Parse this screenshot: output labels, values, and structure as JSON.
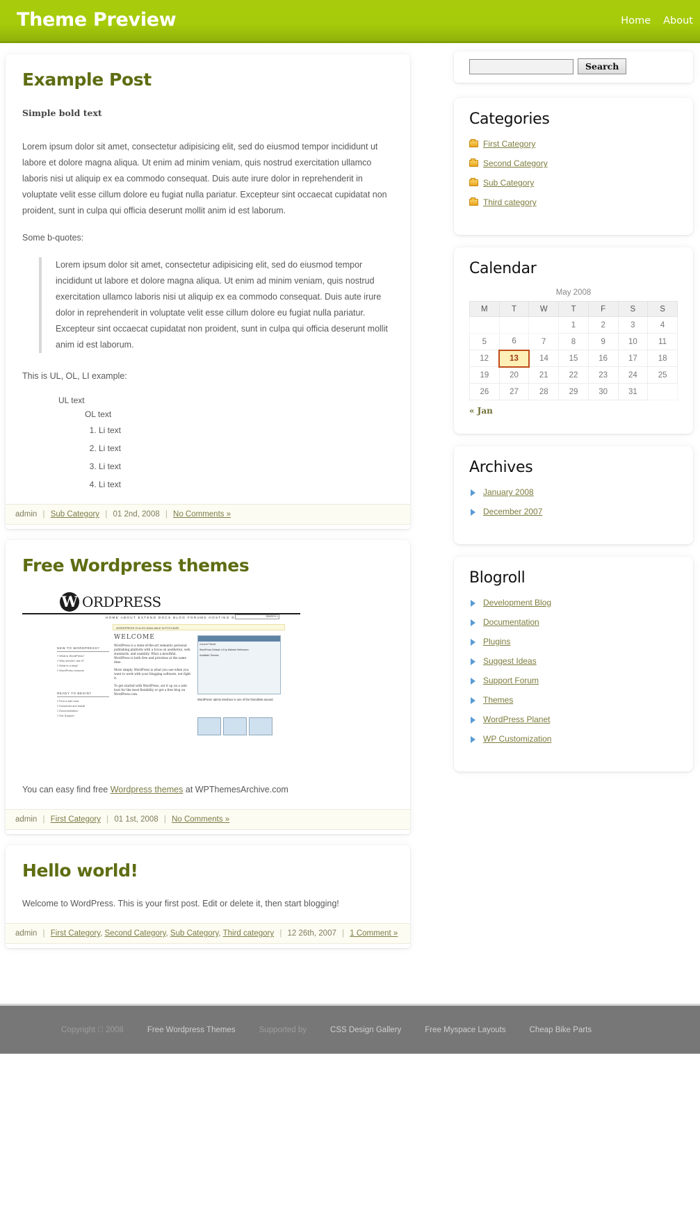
{
  "header": {
    "blog_title": "Theme Preview",
    "nav": [
      {
        "label": "Home"
      },
      {
        "label": "About"
      }
    ]
  },
  "posts": [
    {
      "title": "Example Post",
      "bold_intro": "Simple bold text",
      "paragraph1": "Lorem ipsum dolor sit amet, consectetur adipisicing elit, sed do eiusmod tempor incididunt ut labore et dolore magna aliqua. Ut enim ad minim veniam, quis nostrud exercitation ullamco laboris nisi ut aliquip ex ea commodo consequat. Duis aute irure dolor in reprehenderit in voluptate velit esse cillum dolore eu fugiat nulla pariatur. Excepteur sint occaecat cupidatat non proident, sunt in culpa qui officia deserunt mollit anim id est laborum.",
      "quote_lead": "Some b-quotes:",
      "blockquote": "Lorem ipsum dolor sit amet, consectetur adipisicing elit, sed do eiusmod tempor incididunt ut labore et dolore magna aliqua. Ut enim ad minim veniam, quis nostrud exercitation ullamco laboris nisi ut aliquip ex ea commodo consequat. Duis aute irure dolor in reprehenderit in voluptate velit esse cillum dolore eu fugiat nulla pariatur. Excepteur sint occaecat cupidatat non proident, sunt in culpa qui officia deserunt mollit anim id est laborum.",
      "list_lead": "This is UL, OL, LI example:",
      "ul_text": "UL text",
      "ol_text": "OL text",
      "li_items": [
        "Li text",
        "Li text",
        "Li text",
        "Li text"
      ],
      "meta": {
        "author": "admin",
        "categories": [
          "Sub Category"
        ],
        "date": "01 2nd, 2008",
        "comments": "No Comments »"
      }
    },
    {
      "title": "Free Wordpress themes",
      "caption_pre": "You can easy find free ",
      "caption_link": "Wordpress themes",
      "caption_post": " at WPThemesArchive.com",
      "meta": {
        "author": "admin",
        "categories": [
          "First Category"
        ],
        "date": "01 1st, 2008",
        "comments": "No Comments »"
      }
    },
    {
      "title": "Hello world!",
      "body": "Welcome to WordPress. This is your first post. Edit or delete it, then start blogging!",
      "meta": {
        "author": "admin",
        "categories": [
          "First Category",
          "Second Category",
          "Sub Category",
          "Third category"
        ],
        "date": "12 26th, 2007",
        "comments": "1 Comment »"
      }
    }
  ],
  "screenshot": {
    "wp_mark": "W",
    "wp_word": "ORDPRESS",
    "nav": "HOME    ABOUT    EXTEND    DOCS    BLOG    FORUMS    HOSTING    DOWNLOAD",
    "search_btn": "SEARCH »",
    "notice": "WORDPRESS IS ALSO AVAILABLE IN РУССКИЙ.",
    "left_head1": "NEW TO WORDPRESS?",
    "left_links1": [
      "◊ What is WordPress?",
      "◊ Why should I use it?",
      "◊ What is a blog?",
      "◊ WordPress Lessons"
    ],
    "left_head2": "READY TO BEGIN?",
    "left_links2": [
      "◊ Find a web host",
      "◊ Download and Install",
      "◊ Documentation",
      "◊ Get Support"
    ],
    "welcome": "WELCOME",
    "para1": "WordPress is a state-of-the-art semantic personal publishing platform with a focus on aesthetics, web standards, and usability. What a mouthful. WordPress is both free and priceless at the same time.",
    "para2": "More simply, WordPress is what you use when you want to work with your blogging software, not fight it.",
    "para3": "To get started with WordPress, set it up on a web host for the most flexibility or get a free blog on WordPress.com.",
    "panel_head": "Current Theme",
    "panel_sub": "WordPress Default 1.6 by Michael Heilemann",
    "panel_avail": "Available Themes",
    "caption": "WordPress' admin interface is one of the friendliest around."
  },
  "sidebar": {
    "search": {
      "value": "",
      "placeholder": "",
      "button_label": "Search"
    },
    "categories": {
      "title": "Categories",
      "items": [
        "First Category",
        "Second Category",
        "Sub Category",
        "Third category"
      ]
    },
    "calendar": {
      "title": "Calendar",
      "caption": "May 2008",
      "weekdays": [
        "M",
        "T",
        "W",
        "T",
        "F",
        "S",
        "S"
      ],
      "weeks": [
        [
          "",
          "",
          "",
          "1",
          "2",
          "3",
          "4"
        ],
        [
          "5",
          "6",
          "7",
          "8",
          "9",
          "10",
          "11"
        ],
        [
          "12",
          "13",
          "14",
          "15",
          "16",
          "17",
          "18"
        ],
        [
          "19",
          "20",
          "21",
          "22",
          "23",
          "24",
          "25"
        ],
        [
          "26",
          "27",
          "28",
          "29",
          "30",
          "31",
          ""
        ]
      ],
      "today": "13",
      "prev_label": "« Jan"
    },
    "archives": {
      "title": "Archives",
      "items": [
        "January 2008",
        "December 2007"
      ]
    },
    "blogroll": {
      "title": "Blogroll",
      "items": [
        "Development Blog",
        "Documentation",
        "Plugins",
        "Suggest Ideas",
        "Support Forum",
        "Themes",
        "WordPress Planet",
        "WP Customization"
      ]
    }
  },
  "footer": {
    "items": [
      {
        "label": "Copyright \u0000 2008",
        "dim": true
      },
      {
        "label": "Free Wordpress Themes",
        "dim": false
      },
      {
        "label": "Supported by",
        "dim": true
      },
      {
        "label": "CSS Design Gallery",
        "dim": false
      },
      {
        "label": "Free Myspace Layouts",
        "dim": false
      },
      {
        "label": "Cheap Bike Parts",
        "dim": false
      }
    ]
  }
}
